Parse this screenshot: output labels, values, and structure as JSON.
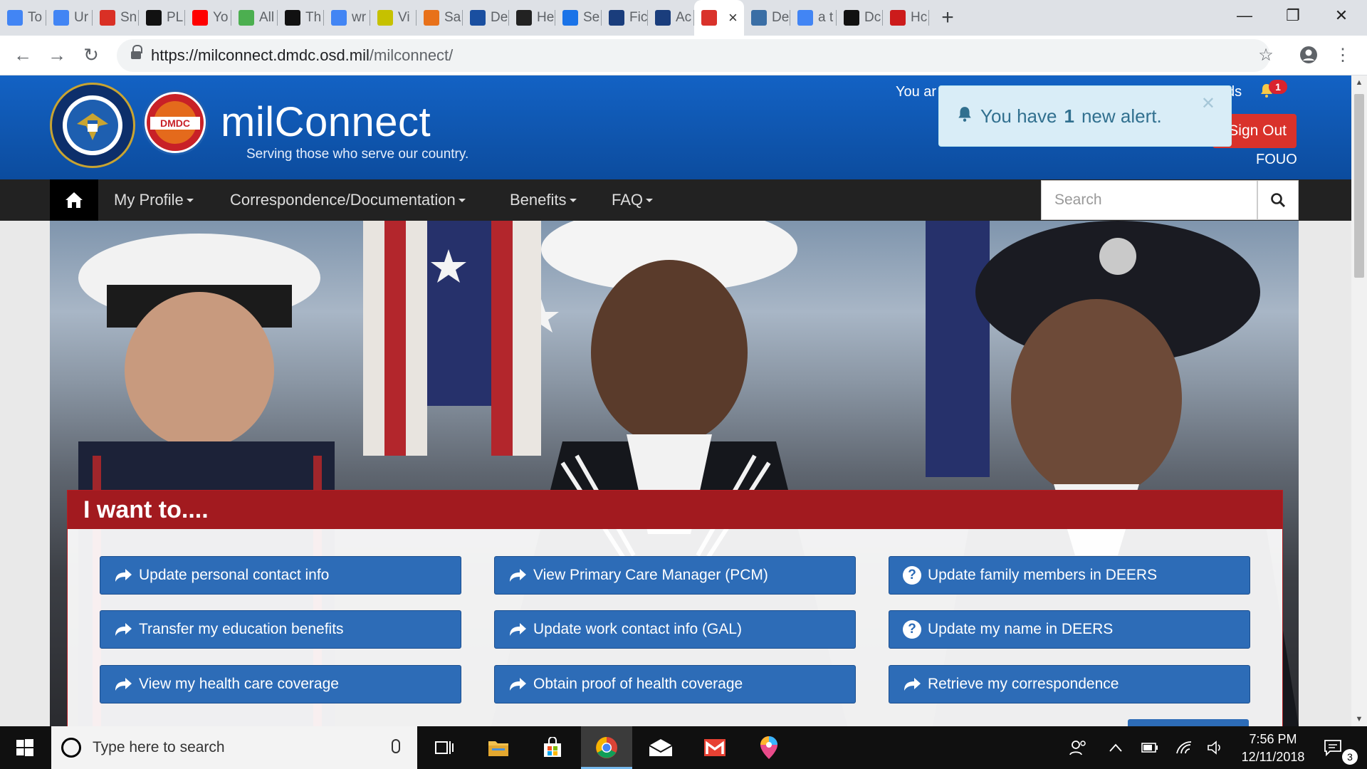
{
  "browser": {
    "tabs": [
      {
        "label": "To",
        "icon": "google-docs-icon",
        "color": "#4285f4"
      },
      {
        "label": "Ur",
        "icon": "google-docs-icon",
        "color": "#4285f4"
      },
      {
        "label": "Sn",
        "icon": "gmail-icon",
        "color": "#d93025"
      },
      {
        "label": "PL",
        "icon": "bc-icon",
        "color": "#111111"
      },
      {
        "label": "Yo",
        "icon": "youtube-icon",
        "color": "#ff0000"
      },
      {
        "label": "All",
        "icon": "checkmark-icon",
        "color": "#4caf50"
      },
      {
        "label": "Th",
        "icon": "github-icon",
        "color": "#111111"
      },
      {
        "label": "wr",
        "icon": "google-icon",
        "color": "#4285f4"
      },
      {
        "label": "Vi",
        "icon": "vi-icon",
        "color": "#c6c100"
      },
      {
        "label": "Sa",
        "icon": "sa-icon",
        "color": "#e8711a"
      },
      {
        "label": "De",
        "icon": "r-icon",
        "color": "#1a4fa0"
      },
      {
        "label": "He",
        "icon": "wikipedia-icon",
        "color": "#222222"
      },
      {
        "label": "Se",
        "icon": "gear-icon",
        "color": "#1a73e8"
      },
      {
        "label": "Fic",
        "icon": "usn-icon",
        "color": "#1a3d7c"
      },
      {
        "label": "Ac",
        "icon": "ac-icon",
        "color": "#1a3d7c"
      },
      {
        "label": "",
        "icon": "dmdc-icon",
        "color": "#d9322b",
        "active": true
      },
      {
        "label": "De",
        "icon": "globe-icon",
        "color": "#3a6ea5"
      },
      {
        "label": "a t",
        "icon": "google-icon",
        "color": "#4285f4"
      },
      {
        "label": "Dc",
        "icon": "m-icon",
        "color": "#111111"
      },
      {
        "label": "Hc",
        "icon": "opera-icon",
        "color": "#cc1b1b"
      }
    ],
    "url_host": "https://milconnect.dmdc.osd.mil",
    "url_path": "/milconnect/"
  },
  "header": {
    "title": "milConnect",
    "subtitle": "Serving those who serve our country.",
    "dmdc_seal_text": "DMDC",
    "user_text_start": "You ar",
    "user_text_end": "ds",
    "alert_count": "1",
    "sign_out_label": "Sign Out",
    "fouo_label": "FOUO"
  },
  "alert": {
    "prefix": "You have",
    "count": "1",
    "suffix": "new alert."
  },
  "nav": {
    "items": [
      {
        "label": "My Profile"
      },
      {
        "label": "Correspondence/Documentation"
      },
      {
        "label": "Benefits"
      },
      {
        "label": "FAQ"
      }
    ],
    "search_placeholder": "Search"
  },
  "panel": {
    "title": "I want to....",
    "buttons": [
      {
        "label": "Update personal contact info",
        "icon": "share-arrow-icon"
      },
      {
        "label": "View Primary Care Manager (PCM)",
        "icon": "share-arrow-icon"
      },
      {
        "label": "Update family members in DEERS",
        "icon": "question-circle-icon"
      },
      {
        "label": "Transfer my education benefits",
        "icon": "share-arrow-icon"
      },
      {
        "label": "Update work contact info (GAL)",
        "icon": "share-arrow-icon"
      },
      {
        "label": "Update my name in DEERS",
        "icon": "question-circle-icon"
      },
      {
        "label": "View my health care coverage",
        "icon": "share-arrow-icon"
      },
      {
        "label": "Obtain proof of health coverage",
        "icon": "share-arrow-icon"
      },
      {
        "label": "Retrieve my correspondence",
        "icon": "share-arrow-icon"
      }
    ]
  },
  "taskbar": {
    "search_placeholder": "Type here to search",
    "time": "7:56 PM",
    "date": "12/11/2018",
    "notification_count": "3"
  },
  "colors": {
    "header_blue": "#1362c4",
    "nav_black": "#222222",
    "panel_red": "#a21a1f",
    "button_blue": "#2d6cb7",
    "sign_out_red": "#d9322b",
    "alert_bg": "#d9edf7"
  }
}
